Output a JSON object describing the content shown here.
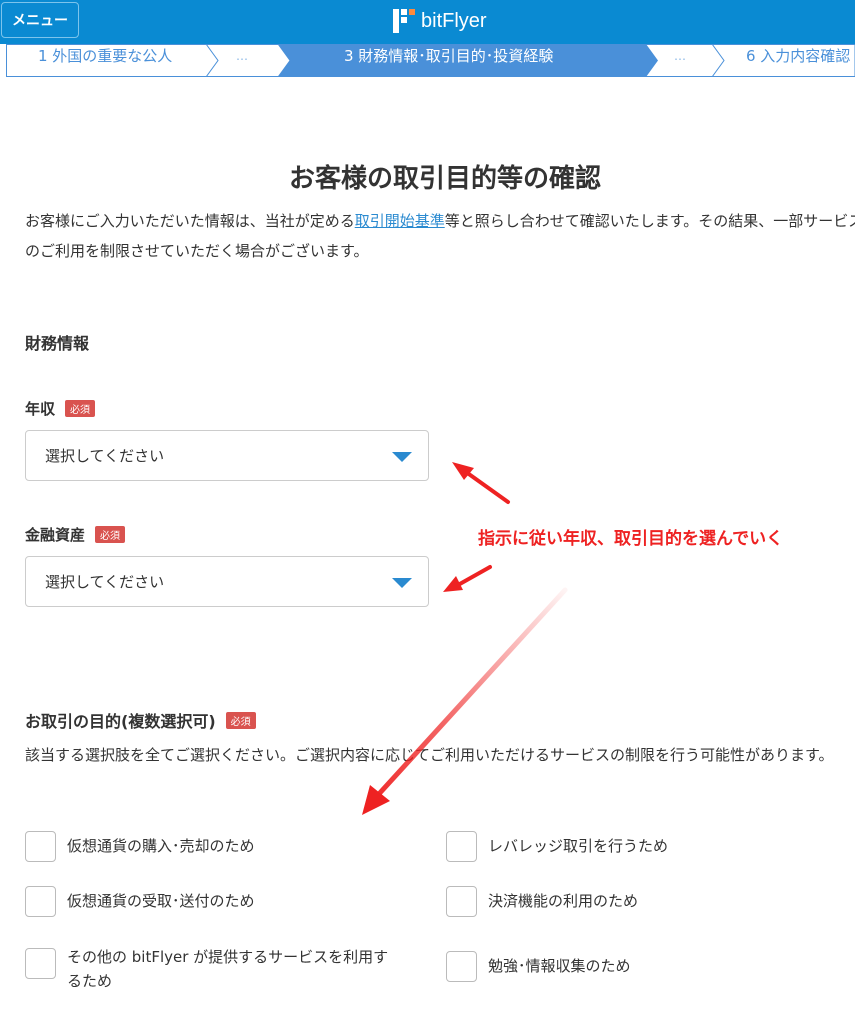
{
  "header": {
    "menu_label": "メニュー",
    "brand": "bitFlyer",
    "background": "#0a8ad2"
  },
  "steps": [
    {
      "label": "1 外国の重要な公人",
      "active": false
    },
    {
      "label": "…",
      "active": false
    },
    {
      "label": "3 財務情報･取引目的･投資経験",
      "active": true
    },
    {
      "label": "…",
      "active": false
    },
    {
      "label": "6 入力内容確認",
      "active": false
    }
  ],
  "page": {
    "title": "お客様の取引目的等の確認",
    "intro_before": "お客様にご入力いただいた情報は、当社が定める",
    "intro_link": "取引開始基準",
    "intro_after": "等と照らし合わせて確認いたします。その結果、一部サービスのご利用を制限させていただく場合がございます。"
  },
  "financial": {
    "heading": "財務情報",
    "income_label": "年収",
    "income_required": "必須",
    "income_placeholder": "選択してください",
    "assets_label": "金融資産",
    "assets_required": "必須",
    "assets_placeholder": "選択してください"
  },
  "purpose": {
    "heading": "お取引の目的(複数選択可)",
    "required": "必須",
    "description": "該当する選択肢を全てご選択ください。ご選択内容に応じてご利用いただけるサービスの制限を行う可能性があります。",
    "options": [
      "仮想通貨の購入･売却のため",
      "レバレッジ取引を行うため",
      "仮想通貨の受取･送付のため",
      "決済機能の利用のため",
      "その他の bitFlyer が提供するサービスを利用するため",
      "勉強･情報収集のため"
    ]
  },
  "annotation": {
    "text": "指示に従い年収、取引目的を選んでいく",
    "color": "#ee2222"
  },
  "colors": {
    "accent": "#2a8ad0",
    "active_step": "#4a90d9",
    "required_badge": "#d9534f"
  }
}
